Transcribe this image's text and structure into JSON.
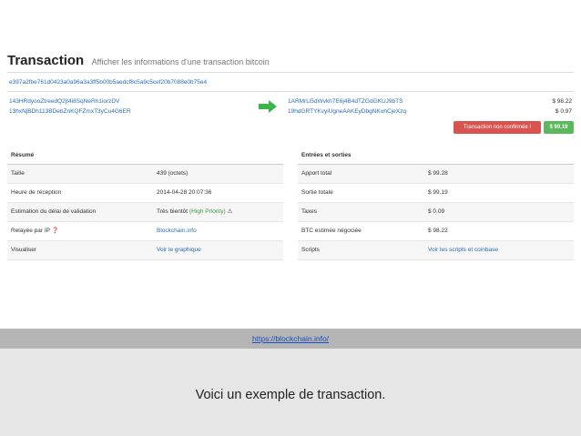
{
  "header": {
    "title": "Transaction",
    "subtitle": "Afficher les informations d'une transaction bitcoin"
  },
  "tx": {
    "hash": "e397a2fbe761d0423a0a96a3a3ff5b00b5aedcf8c5a9c5cef20b7088e0b75e4",
    "inputs": [
      "143HRdyooZtreedQ2jt4i8SqNeRh1iorzDV",
      "13hxNjBDh113BDebZnKQFZmxT3yCu4G6ER"
    ],
    "outputs": [
      {
        "address": "1ARMrLi5dWvkh7E6j4B4dTZGdGKUJ9bTS",
        "amount": "$ 98.22"
      },
      {
        "address": "19hdGRTYKvyiUgneAAKEyDbgNKohCjeXzq",
        "amount": "$ 0.97"
      }
    ],
    "status_badge": "Transaction non confirmée !",
    "total_badge": "$ 99.19"
  },
  "summary": {
    "heading": "Résumé",
    "rows": [
      {
        "k": "Taille",
        "v": "439 (octets)"
      },
      {
        "k": "Heure de réception",
        "v": "2014-04-28 20:07:36"
      },
      {
        "k": "Estimation du délai de validation",
        "v": "Très bientôt",
        "extra": "(High Priority)",
        "warn": "⚠"
      },
      {
        "k": "Relayée par IP",
        "k_icon": "❓",
        "v": "Blockchain.info"
      },
      {
        "k": "Visualiser",
        "v": "Voir le graphique"
      }
    ]
  },
  "io": {
    "heading": "Entrées et sorties",
    "rows": [
      {
        "k": "Apport total",
        "v": "$ 99.28"
      },
      {
        "k": "Sortie totale",
        "v": "$ 99.19"
      },
      {
        "k": "Taxes",
        "v": "$ 0.09"
      },
      {
        "k": "BTC estimée négociée",
        "v": "$ 98.22"
      },
      {
        "k": "Scripts",
        "v": "Voir les scripts et coinbase"
      }
    ]
  },
  "footer": {
    "url": "https://blockchain.info/",
    "caption": "Voici un exemple de transaction."
  },
  "colors": {
    "link": "#2a6bb8",
    "danger": "#d9534f",
    "success": "#5cb85c",
    "band": "#b5b5b5",
    "slide_bg": "#e6e6e6"
  },
  "icons": {
    "arrow": "arrow-right-icon",
    "help": "question-circle-icon",
    "warning": "warning-icon"
  }
}
